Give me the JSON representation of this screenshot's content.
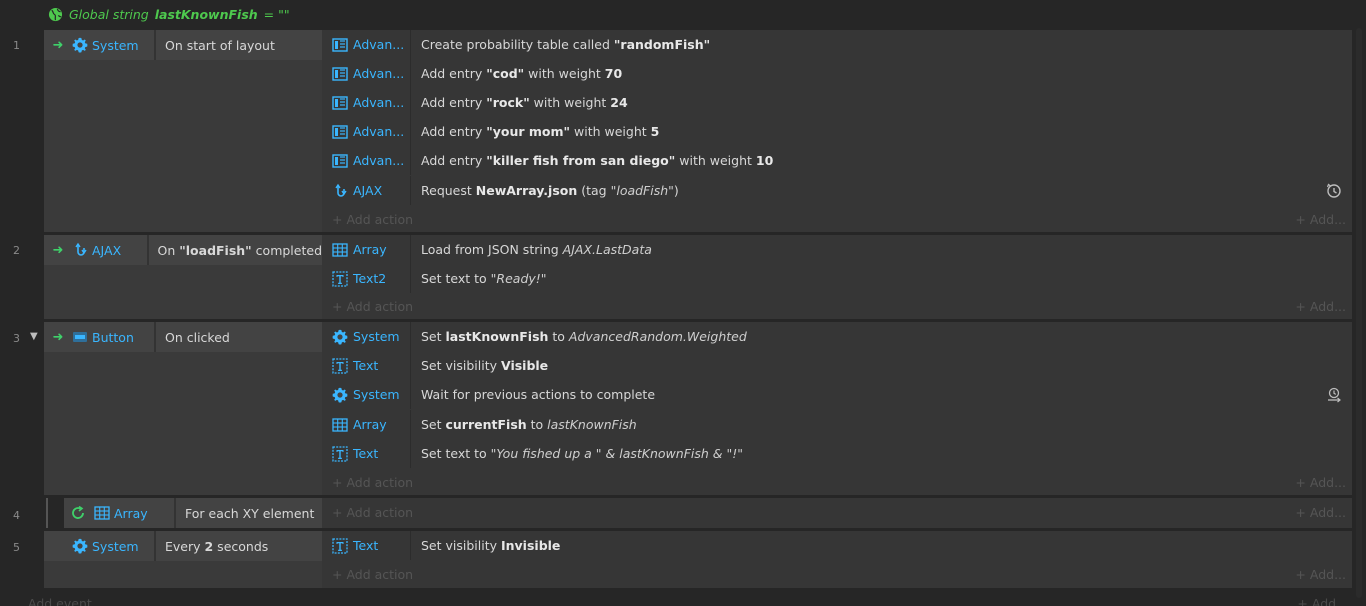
{
  "global_var": {
    "prefix": "Global string",
    "name": "lastKnownFish",
    "suffix": "= \"\""
  },
  "add_action": "Add action",
  "add_short": "Add...",
  "add_event": "Add event",
  "add_event_right": "Add...",
  "colors": {
    "object": "#3ab6ff",
    "trigger": "#3fd16a",
    "global": "#4ec94e"
  },
  "events": [
    {
      "number": "1",
      "condition": {
        "object": "System",
        "icon": "gear-icon",
        "text": "On start of layout"
      },
      "actions": [
        {
          "object": "Advan...",
          "icon": "advanced-random-icon",
          "a": "Create probability table called ",
          "b": "\"randomFish\""
        },
        {
          "object": "Advan...",
          "icon": "advanced-random-icon",
          "a": "Add entry ",
          "b": "\"cod\"",
          "c": " with weight ",
          "d": "70"
        },
        {
          "object": "Advan...",
          "icon": "advanced-random-icon",
          "a": "Add entry ",
          "b": "\"rock\"",
          "c": " with weight ",
          "d": "24"
        },
        {
          "object": "Advan...",
          "icon": "advanced-random-icon",
          "a": "Add entry ",
          "b": "\"your mom\"",
          "c": " with weight ",
          "d": "5"
        },
        {
          "object": "Advan...",
          "icon": "advanced-random-icon",
          "a": "Add entry ",
          "b": "\"killer fish from san diego\"",
          "c": " with weight ",
          "d": "10"
        },
        {
          "object": "AJAX",
          "icon": "ajax-icon",
          "a": "Request ",
          "b": "NewArray.json",
          "c": " (tag ",
          "d": "\"loadFish\"",
          "e": ")"
        }
      ]
    },
    {
      "number": "2",
      "condition": {
        "object": "AJAX",
        "icon": "ajax-icon",
        "pre": "On ",
        "bold": "\"loadFish\"",
        "post": " completed"
      },
      "actions": [
        {
          "object": "Array",
          "icon": "array-icon",
          "a": "Load from JSON string ",
          "b": "AJAX.LastData"
        },
        {
          "object": "Text2",
          "icon": "text-icon",
          "a": "Set text to ",
          "b": "\"Ready!\""
        }
      ]
    },
    {
      "number": "3",
      "condition": {
        "object": "Button",
        "icon": "button-icon",
        "text": "On clicked"
      },
      "actions": [
        {
          "object": "System",
          "icon": "gear-icon",
          "a": "Set ",
          "b": "lastKnownFish",
          "c": " to ",
          "d": "AdvancedRandom.Weighted"
        },
        {
          "object": "Text",
          "icon": "text-icon",
          "a": "Set visibility ",
          "b": "Visible"
        },
        {
          "object": "System",
          "icon": "gear-icon",
          "a": "Wait for previous actions to complete"
        },
        {
          "object": "Array",
          "icon": "array-icon",
          "a": "Set ",
          "b": "currentFish",
          "c": " to ",
          "d": "lastKnownFish"
        },
        {
          "object": "Text",
          "icon": "text-icon",
          "a": "Set text to ",
          "b": "\"You fished up a \" & lastKnownFish & \"!\""
        }
      ]
    },
    {
      "number": "4",
      "condition": {
        "object": "Array",
        "icon": "array-icon",
        "text": "For each XY element"
      }
    },
    {
      "number": "5",
      "condition": {
        "object": "System",
        "icon": "gear-icon",
        "pre": "Every ",
        "bold": "2",
        "post": " seconds"
      },
      "actions": [
        {
          "object": "Text",
          "icon": "text-icon",
          "a": "Set visibility ",
          "b": "Invisible"
        }
      ]
    }
  ]
}
